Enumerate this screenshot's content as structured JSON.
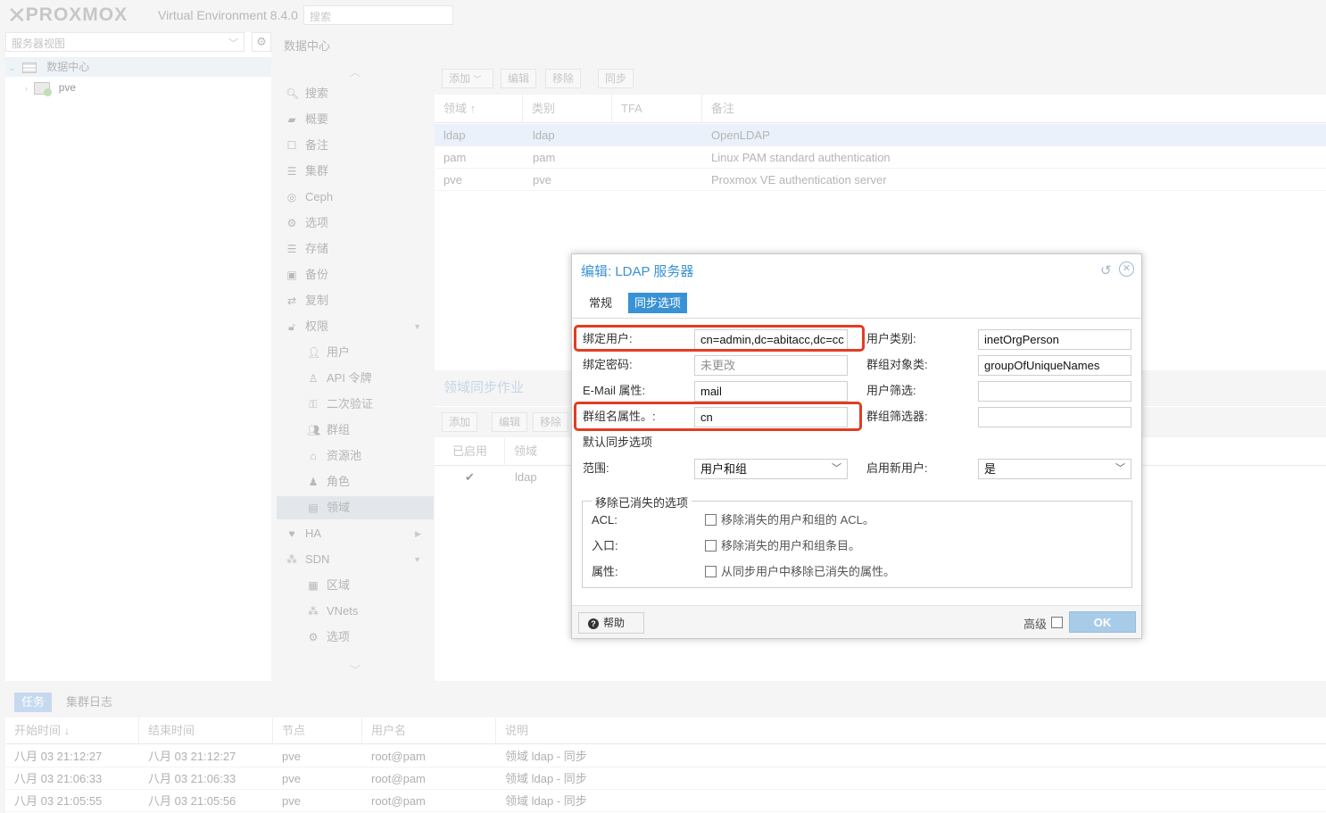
{
  "app": {
    "logo_text": "PROXMOX",
    "version": "Virtual Environment 8.4.0",
    "search_placeholder": "搜索"
  },
  "left": {
    "view_select": "服务器视图",
    "tree": [
      {
        "label": "数据中心"
      },
      {
        "label": "pve"
      }
    ]
  },
  "breadcrumb": "数据中心",
  "nav": [
    {
      "label": "搜索",
      "icon": "search-icon"
    },
    {
      "label": "概要",
      "icon": "book-icon"
    },
    {
      "label": "备注",
      "icon": "note-icon"
    },
    {
      "label": "集群",
      "icon": "server-icon"
    },
    {
      "label": "Ceph",
      "icon": "ceph-icon"
    },
    {
      "label": "选项",
      "icon": "gear-icon"
    },
    {
      "label": "存储",
      "icon": "database-icon"
    },
    {
      "label": "备份",
      "icon": "floppy-icon"
    },
    {
      "label": "复制",
      "icon": "retweet-icon"
    },
    {
      "label": "权限",
      "icon": "unlock-icon"
    },
    {
      "label": "用户",
      "icon": "user-icon"
    },
    {
      "label": "API 令牌",
      "icon": "user-outline-icon"
    },
    {
      "label": "二次验证",
      "icon": "key-icon"
    },
    {
      "label": "群组",
      "icon": "users-icon"
    },
    {
      "label": "资源池",
      "icon": "tags-icon"
    },
    {
      "label": "角色",
      "icon": "male-icon"
    },
    {
      "label": "领域",
      "icon": "address-book-icon"
    },
    {
      "label": "HA",
      "icon": "heartbeat-icon"
    },
    {
      "label": "SDN",
      "icon": "sdn-icon"
    },
    {
      "label": "区域",
      "icon": "grid-icon"
    },
    {
      "label": "VNets",
      "icon": "network-icon"
    },
    {
      "label": "选项",
      "icon": "gear-icon"
    }
  ],
  "realm_toolbar": {
    "add": "添加",
    "edit": "编辑",
    "remove": "移除",
    "sync": "同步"
  },
  "realm_columns": [
    "领域 ↑",
    "类别",
    "TFA",
    "备注"
  ],
  "realms": [
    {
      "realm": "ldap",
      "type": "ldap",
      "tfa": "",
      "comment": "OpenLDAP"
    },
    {
      "realm": "pam",
      "type": "pam",
      "tfa": "",
      "comment": "Linux PAM standard authentication"
    },
    {
      "realm": "pve",
      "type": "pve",
      "tfa": "",
      "comment": "Proxmox VE authentication server"
    }
  ],
  "sync_jobs": {
    "title": "领域同步作业",
    "toolbar": {
      "add": "添加",
      "edit": "编辑",
      "remove": "移除"
    },
    "columns": [
      "已启用",
      "领域"
    ],
    "rows": [
      {
        "enabled": "✔",
        "realm": "ldap"
      }
    ]
  },
  "bottom": {
    "tabs": [
      "任务",
      "集群日志"
    ],
    "columns": [
      "开始时间 ↓",
      "结束时间",
      "节点",
      "用户名",
      "说明"
    ],
    "rows": [
      {
        "start": "八月 03 21:12:27",
        "end": "八月 03 21:12:27",
        "node": "pve",
        "user": "root@pam",
        "desc": "领域 ldap - 同步"
      },
      {
        "start": "八月 03 21:06:33",
        "end": "八月 03 21:06:33",
        "node": "pve",
        "user": "root@pam",
        "desc": "领域 ldap - 同步"
      },
      {
        "start": "八月 03 21:05:55",
        "end": "八月 03 21:05:56",
        "node": "pve",
        "user": "root@pam",
        "desc": "领域 ldap - 同步"
      }
    ]
  },
  "dialog": {
    "title": "编辑: LDAP 服务器",
    "tabs": [
      "常规",
      "同步选项"
    ],
    "bind_user_label": "绑定用户:",
    "bind_user_value": "cn=admin,dc=abitacc,dc=cc",
    "bind_pass_label": "绑定密码:",
    "bind_pass_placeholder": "未更改",
    "email_label": "E-Mail 属性:",
    "email_value": "mail",
    "groupname_label": "群组名属性。:",
    "groupname_value": "cn",
    "user_class_label": "用户类别:",
    "user_class_value": "inetOrgPerson",
    "group_class_label": "群组对象类:",
    "group_class_value": "groupOfUniqueNames",
    "user_filter_label": "用户筛选:",
    "user_filter_value": "",
    "group_filter_label": "群组筛选器:",
    "group_filter_value": "",
    "default_sync_heading": "默认同步选项",
    "scope_label": "范围:",
    "scope_value": "用户和组",
    "enable_new_label": "启用新用户:",
    "enable_new_value": "是",
    "remove_legend": "移除已消失的选项",
    "acl_label": "ACL:",
    "acl_text": "移除消失的用户和组的 ACL。",
    "entry_label": "入口:",
    "entry_text": "移除消失的用户和组条目。",
    "props_label": "属性:",
    "props_text": "从同步用户中移除已消失的属性。",
    "help": "帮助",
    "advanced": "高级",
    "ok": "OK"
  },
  "colors": {
    "accent": "#3892d4",
    "highlight": "#e23c21"
  }
}
